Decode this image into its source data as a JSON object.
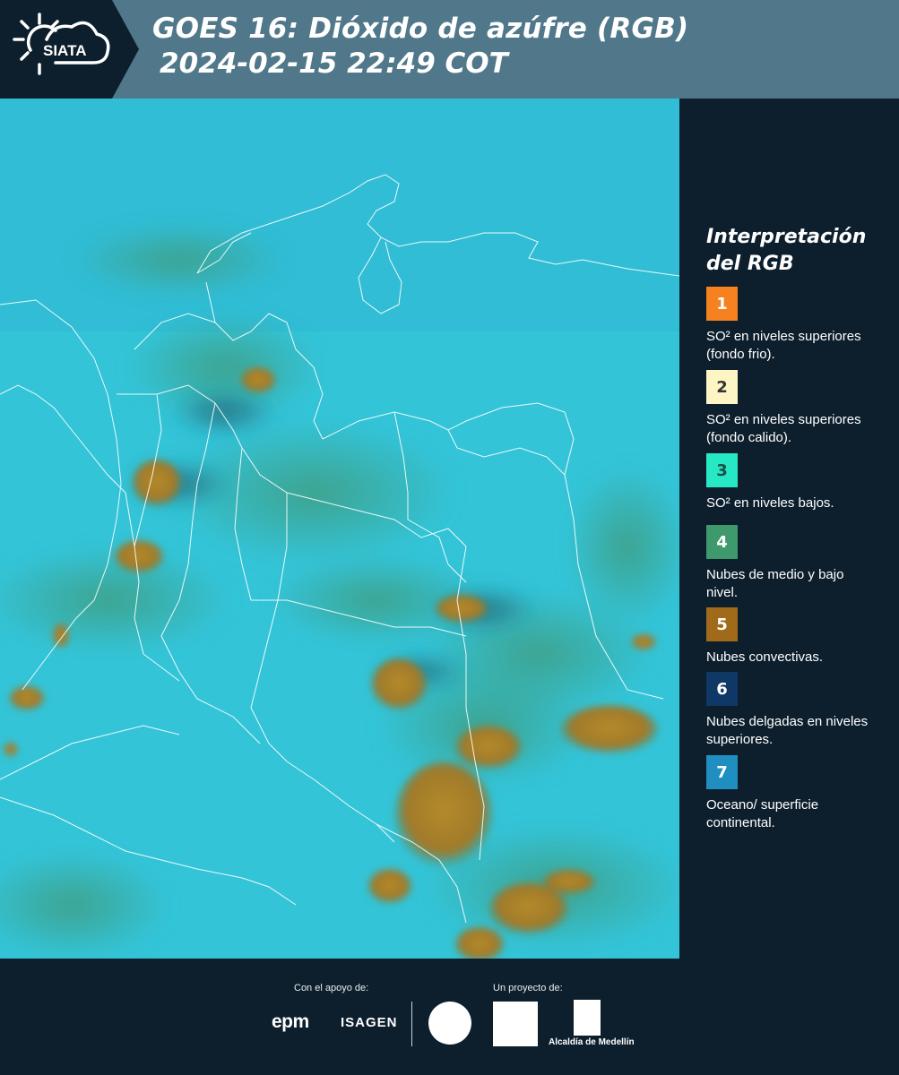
{
  "header": {
    "logo_text": "SIATA",
    "title_line1": "GOES 16: Dióxido de azúfre (RGB)",
    "title_line2": "2024-02-15 22:49 COT"
  },
  "legend": {
    "title_line1": "Interpretación",
    "title_line2": "del RGB",
    "items": [
      {
        "number": "1",
        "color": "#f5821f",
        "text_color": "#ffffff",
        "label": "SO² en niveles superiores (fondo frio)."
      },
      {
        "number": "2",
        "color": "#fdf5c4",
        "text_color": "#333333",
        "label": "SO² en niveles superiores (fondo calido)."
      },
      {
        "number": "3",
        "color": "#27e8c4",
        "text_color": "#1d4d4a",
        "label": "SO² en niveles bajos."
      },
      {
        "number": "4",
        "color": "#3e9a6d",
        "text_color": "#ffffff",
        "label": "Nubes de medio y bajo nivel."
      },
      {
        "number": "5",
        "color": "#a16a1a",
        "text_color": "#ffffff",
        "label": "Nubes convectivas."
      },
      {
        "number": "6",
        "color": "#0f3866",
        "text_color": "#ffffff",
        "label": "Nubes delgadas en niveles superiores."
      },
      {
        "number": "7",
        "color": "#1e8fc0",
        "text_color": "#ffffff",
        "label": "Oceano/ superficie continental."
      }
    ]
  },
  "footer": {
    "support_label": "Con el apoyo de:",
    "project_label": "Un proyecto de:",
    "epm": "epm",
    "isagen": "ISAGEN",
    "alcaldia": "Alcaldía de Medellín"
  },
  "map": {
    "ocean_color": "#33c2d6",
    "convective_color": "#a8842c",
    "midcloud_color": "#3fae8c"
  }
}
